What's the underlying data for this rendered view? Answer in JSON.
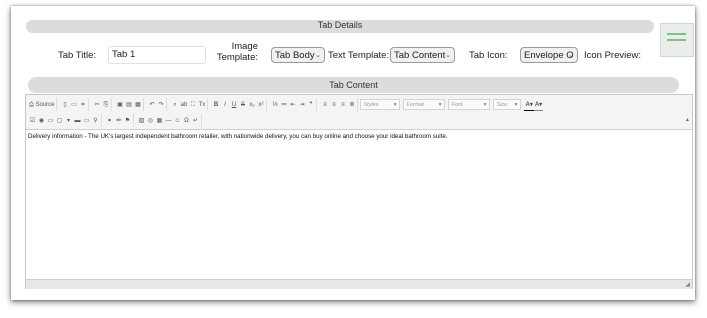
{
  "tab_details": {
    "section_title": "Tab Details",
    "title_label": "Tab Title:",
    "title_value": "Tab 1",
    "image_template_label": "Image Template:",
    "image_template_value": "Tab Body",
    "text_template_label": "Text Template:",
    "text_template_value": "Tab Content",
    "icon_label": "Tab Icon:",
    "icon_value": "Envelope O",
    "icon_preview_label": "Icon Preview:"
  },
  "tab_content": {
    "section_title": "Tab Content",
    "editor_text": "Delivery information - The UK's largest independent bathroom retailer, with nationwide delivery, you can buy online and choose your ideal bathroom suite."
  },
  "toolbar": {
    "source_label": "Source",
    "styles_label": "Styles",
    "format_label": "Format",
    "font_label": "Font",
    "size_label": "Size",
    "row1_groups": [
      [
        "new-page",
        "preview",
        "templates"
      ],
      [
        "cut",
        "copy"
      ],
      [
        "paste",
        "paste-text",
        "paste-word"
      ],
      [
        "undo",
        "redo"
      ],
      [
        "find",
        "replace",
        "select-all",
        "remove-format"
      ],
      [
        "bold",
        "italic",
        "underline",
        "strike",
        "subscript",
        "superscript"
      ],
      [
        "numbered-list",
        "bulleted-list",
        "outdent",
        "indent",
        "blockquote"
      ],
      [
        "align-left",
        "align-center",
        "align-right",
        "justify"
      ]
    ],
    "row1_glyphs": [
      [
        "▯",
        "▭",
        "⌗"
      ],
      [
        "✂",
        "⎘"
      ],
      [
        "▣",
        "▤",
        "▦"
      ],
      [
        "↶",
        "↷"
      ],
      [
        "⌕",
        "ab",
        "⛶",
        "Tx"
      ],
      [
        "B",
        "I",
        "U",
        "S",
        "x₂",
        "x²"
      ],
      [
        "⅓",
        "≔",
        "⇤",
        "⇥",
        "❞"
      ],
      [
        "≡",
        "≡",
        "≡",
        "≣"
      ]
    ],
    "row2_groups": [
      [
        "checkbox",
        "radio",
        "text-field",
        "textarea",
        "select",
        "button",
        "image-button",
        "hidden-field"
      ],
      [
        "link",
        "unlink",
        "anchor"
      ],
      [
        "image",
        "flash",
        "table",
        "horizontal-line",
        "smiley",
        "special-char",
        "page-break"
      ]
    ],
    "row2_glyphs": [
      [
        "☑",
        "◉",
        "▭",
        "▢",
        "▾",
        "▬",
        "▭",
        "⚲"
      ],
      [
        "⚭",
        "⚮",
        "⚑"
      ],
      [
        "▨",
        "◎",
        "▦",
        "―",
        "☺",
        "Ω",
        "↵"
      ]
    ],
    "text_color_glyph": "A",
    "bg_color_glyph": "A"
  },
  "colors": {
    "section_bar": "#dcdcdc",
    "toolbar_bg": "#f4f4f4",
    "widget_accent": "#7fbf8b"
  }
}
